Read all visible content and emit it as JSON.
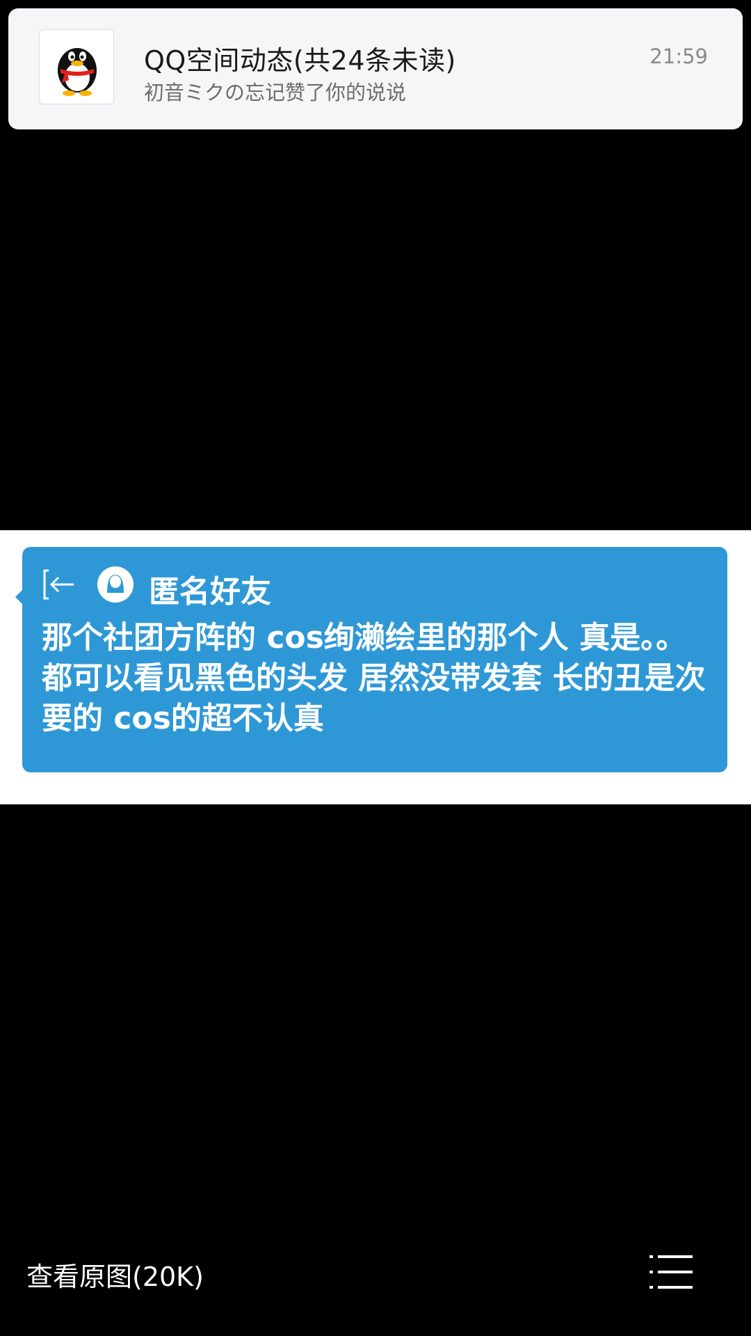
{
  "notification": {
    "app_icon": "qq-penguin-icon",
    "title": "QQ空间动态(共24条未读)",
    "body": "初音ミクの忘记赞了你的说说",
    "time": "21:59"
  },
  "image_content": {
    "sender": "匿名好友",
    "message": "那个社团方阵的 cos绚濑绘里的那个人 真是。。都可以看见黑色的头发 居然没带发套 长的丑是次要的 cos的超不认真",
    "icons": [
      "exit-arrow-icon",
      "anonymous-avatar-icon"
    ],
    "bubble_color": "#2e98d6"
  },
  "bottom_bar": {
    "view_original_label": "查看原图(20K)",
    "menu_icon": "list-menu-icon"
  },
  "colors": {
    "background": "#000000",
    "notification_bg": "#f6f6f8"
  }
}
